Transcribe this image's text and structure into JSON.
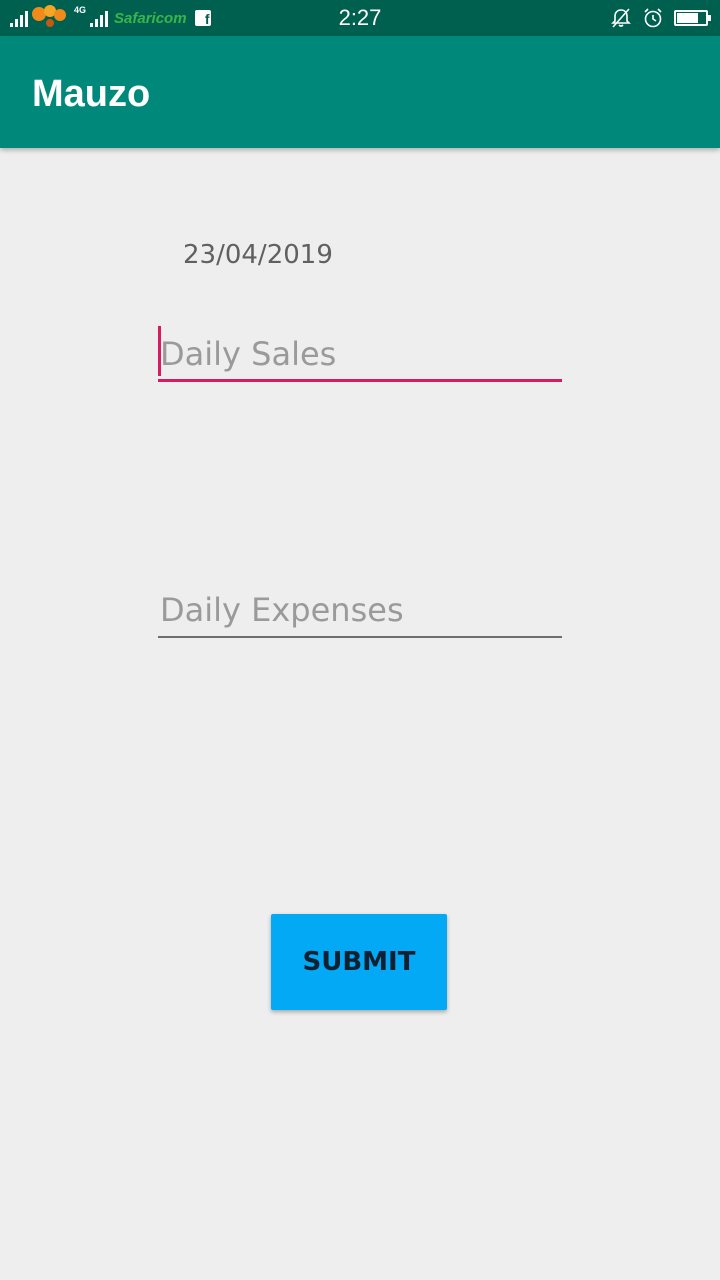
{
  "status_bar": {
    "time": "2:27",
    "network_type": "4G",
    "carrier": "Safaricom",
    "battery_level": 0.75,
    "icons": [
      "signal-icon",
      "loop-icon",
      "signal-icon",
      "safaricom-logo",
      "facebook-icon",
      "notifications-off-icon",
      "alarm-icon",
      "battery-icon"
    ]
  },
  "app_bar": {
    "title": "Mauzo"
  },
  "form": {
    "date": "23/04/2019",
    "daily_sales": {
      "value": "",
      "placeholder": "Daily Sales"
    },
    "daily_expenses": {
      "value": "",
      "placeholder": "Daily Expenses"
    },
    "submit_label": "SUBMIT"
  },
  "colors": {
    "status_bar": "#00604f",
    "app_bar": "#00897b",
    "accent": "#d81b60",
    "button": "#03a9f4",
    "background": "#eeeeee"
  }
}
